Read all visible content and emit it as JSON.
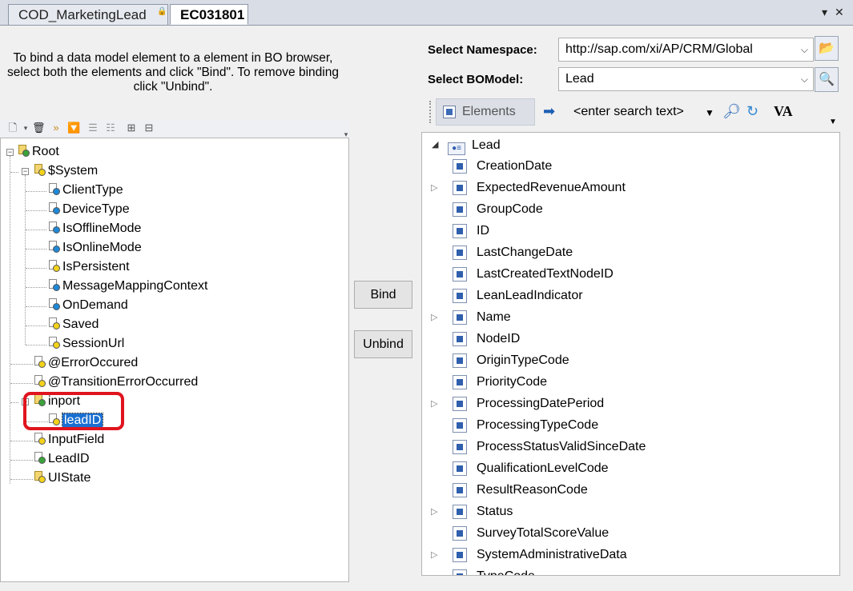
{
  "tabs": [
    {
      "label": "COD_MarketingLead",
      "active": false
    },
    {
      "label": "EC031801",
      "active": true
    }
  ],
  "instruction": "To bind a data model element to a element in BO browser, select both the elements and click \"Bind\". To remove binding click \"Unbind\".",
  "buttons": {
    "bind": "Bind",
    "unbind": "Unbind"
  },
  "namespace": {
    "label": "Select Namespace:",
    "value": "http://sap.com/xi/AP/CRM/Global"
  },
  "bomodel": {
    "label": "Select BOModel:",
    "value": "Lead"
  },
  "right_toolbar": {
    "elements_label": "Elements",
    "search_placeholder": "<enter search text>",
    "va_label": "VA"
  },
  "left_tree": [
    {
      "label": "Root",
      "icon": "root-folder",
      "depth": 0
    },
    {
      "label": "$System",
      "icon": "folder",
      "depth": 1
    },
    {
      "label": "ClientType",
      "icon": "blue-field",
      "depth": 2
    },
    {
      "label": "DeviceType",
      "icon": "blue-field",
      "depth": 2
    },
    {
      "label": "IsOfflineMode",
      "icon": "blue-field",
      "depth": 2
    },
    {
      "label": "IsOnlineMode",
      "icon": "blue-field",
      "depth": 2
    },
    {
      "label": "IsPersistent",
      "icon": "yellow-field",
      "depth": 2
    },
    {
      "label": "MessageMappingContext",
      "icon": "blue-field",
      "depth": 2
    },
    {
      "label": "OnDemand",
      "icon": "blue-field",
      "depth": 2
    },
    {
      "label": "Saved",
      "icon": "yellow-field",
      "depth": 2
    },
    {
      "label": "SessionUrl",
      "icon": "yellow-field",
      "depth": 2
    },
    {
      "label": "@ErrorOccured",
      "icon": "yellow-field",
      "depth": 1
    },
    {
      "label": "@TransitionErrorOccurred",
      "icon": "yellow-field",
      "depth": 1
    },
    {
      "label": "inport",
      "icon": "green-folder",
      "depth": 1
    },
    {
      "label": "leadID",
      "icon": "yellow-field",
      "depth": 2,
      "selected": true
    },
    {
      "label": "InputField",
      "icon": "yellow-field",
      "depth": 1
    },
    {
      "label": "LeadID",
      "icon": "green-field",
      "depth": 1
    },
    {
      "label": "UIState",
      "icon": "folder",
      "depth": 1
    }
  ],
  "right_tree": {
    "root": "Lead",
    "items": [
      {
        "label": "CreationDate",
        "expandable": false
      },
      {
        "label": "ExpectedRevenueAmount",
        "expandable": true
      },
      {
        "label": "GroupCode",
        "expandable": false
      },
      {
        "label": "ID",
        "expandable": false
      },
      {
        "label": "LastChangeDate",
        "expandable": false
      },
      {
        "label": "LastCreatedTextNodeID",
        "expandable": false
      },
      {
        "label": "LeanLeadIndicator",
        "expandable": false
      },
      {
        "label": "Name",
        "expandable": true
      },
      {
        "label": "NodeID",
        "expandable": false
      },
      {
        "label": "OriginTypeCode",
        "expandable": false
      },
      {
        "label": "PriorityCode",
        "expandable": false
      },
      {
        "label": "ProcessingDatePeriod",
        "expandable": true
      },
      {
        "label": "ProcessingTypeCode",
        "expandable": false
      },
      {
        "label": "ProcessStatusValidSinceDate",
        "expandable": false
      },
      {
        "label": "QualificationLevelCode",
        "expandable": false
      },
      {
        "label": "ResultReasonCode",
        "expandable": false
      },
      {
        "label": "Status",
        "expandable": true
      },
      {
        "label": "SurveyTotalScoreValue",
        "expandable": false
      },
      {
        "label": "SystemAdministrativeData",
        "expandable": true
      },
      {
        "label": "TypeCode",
        "expandable": false
      }
    ]
  }
}
